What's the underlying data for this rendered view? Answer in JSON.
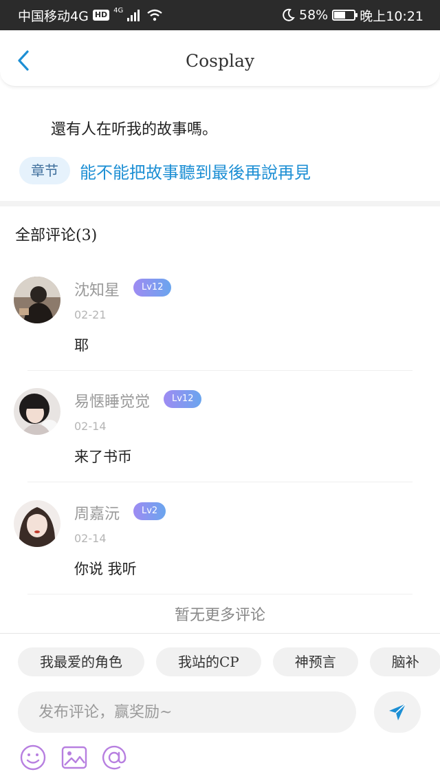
{
  "status_bar": {
    "carrier": "中国移动4G",
    "hd": "HD",
    "signal_label": "4G",
    "battery_percent": "58%",
    "battery_level": 0.58,
    "time": "晚上10:21"
  },
  "header": {
    "title": "Cosplay",
    "back_icon": "chevron-left-icon"
  },
  "article": {
    "text": "還有人在听我的故事嗎。",
    "chapter_tag": "章节",
    "chapter_title": "能不能把故事聽到最後再說再見"
  },
  "comments_section": {
    "heading": "全部评论(3)",
    "comments": [
      {
        "username": "沈知星",
        "level": "Lv12",
        "date": "02-21",
        "text": "耶"
      },
      {
        "username": "易惬睡觉觉",
        "level": "Lv12",
        "date": "02-14",
        "text": "来了书币"
      },
      {
        "username": "周嘉沅",
        "level": "Lv2",
        "date": "02-14",
        "text": "你说 我听"
      }
    ],
    "no_more": "暂无更多评论"
  },
  "bottom": {
    "chips": [
      "我最爱的角色",
      "我站的CP",
      "神预言",
      "脑补"
    ],
    "input_placeholder": "发布评论，赢奖励~",
    "send_icon": "send-icon",
    "tool_icons": [
      "emoji-icon",
      "image-icon",
      "at-icon"
    ]
  },
  "colors": {
    "accent": "#1d8fd4",
    "level_badge_start": "#9e8bf2",
    "level_badge_end": "#6aa5ee",
    "tool_icon": "#b77fe0"
  }
}
